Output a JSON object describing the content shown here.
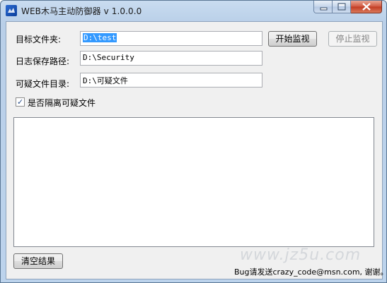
{
  "window": {
    "title": "WEB木马主动防御器 v 1.0.0.0"
  },
  "form": {
    "target_folder_label": "目标文件夹:",
    "target_folder_value": "D:\\test",
    "log_path_label": "日志保存路径:",
    "log_path_value": "D:\\Security",
    "suspicious_dir_label": "可疑文件目录:",
    "suspicious_dir_value": "D:\\可疑文件",
    "isolate_checkbox_label": "是否隔离可疑文件",
    "isolate_checked": true
  },
  "buttons": {
    "start_label": "开始监视",
    "stop_label": "停止监视",
    "clear_label": "清空结果"
  },
  "footer": {
    "text": "Bug请发送crazy_code@msn.com, 谢谢。"
  },
  "watermark": "www.jz5u.com",
  "colors": {
    "selection": "#3399ff",
    "dialog_bg": "#f0f0f0"
  }
}
